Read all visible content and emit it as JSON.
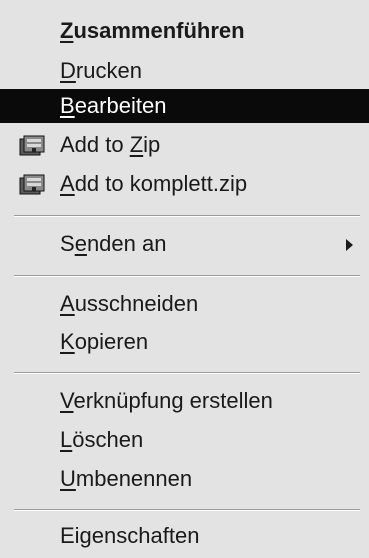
{
  "menu": {
    "items": [
      {
        "pre": "",
        "key": "Z",
        "post": "usammenführen"
      },
      {
        "pre": "",
        "key": "D",
        "post": "rucken"
      },
      {
        "pre": "",
        "key": "B",
        "post": "earbeiten"
      },
      {
        "pre": "Add to ",
        "key": "Z",
        "post": "ip"
      },
      {
        "pre": "",
        "key": "A",
        "post": "dd to komplett.zip"
      },
      {
        "pre": "S",
        "key": "e",
        "post": "nden an"
      },
      {
        "pre": "",
        "key": "A",
        "post": "usschneiden"
      },
      {
        "pre": "",
        "key": "K",
        "post": "opieren"
      },
      {
        "pre": "",
        "key": "V",
        "post": "erknüpfung erstellen"
      },
      {
        "pre": "",
        "key": "L",
        "post": "öschen"
      },
      {
        "pre": "",
        "key": "U",
        "post": "mbenennen"
      },
      {
        "pre": "Eigenschaften",
        "key": "",
        "post": ""
      }
    ],
    "icons": {
      "add_to_zip": "winzip-icon",
      "add_to_komplett_zip": "winzip-icon",
      "senden_an": "submenu-arrow-icon"
    },
    "colors": {
      "background": "#e3e3e3",
      "highlight": "#0a0a0a",
      "highlight_text": "#ffffff",
      "text": "#1a1a1a"
    }
  }
}
